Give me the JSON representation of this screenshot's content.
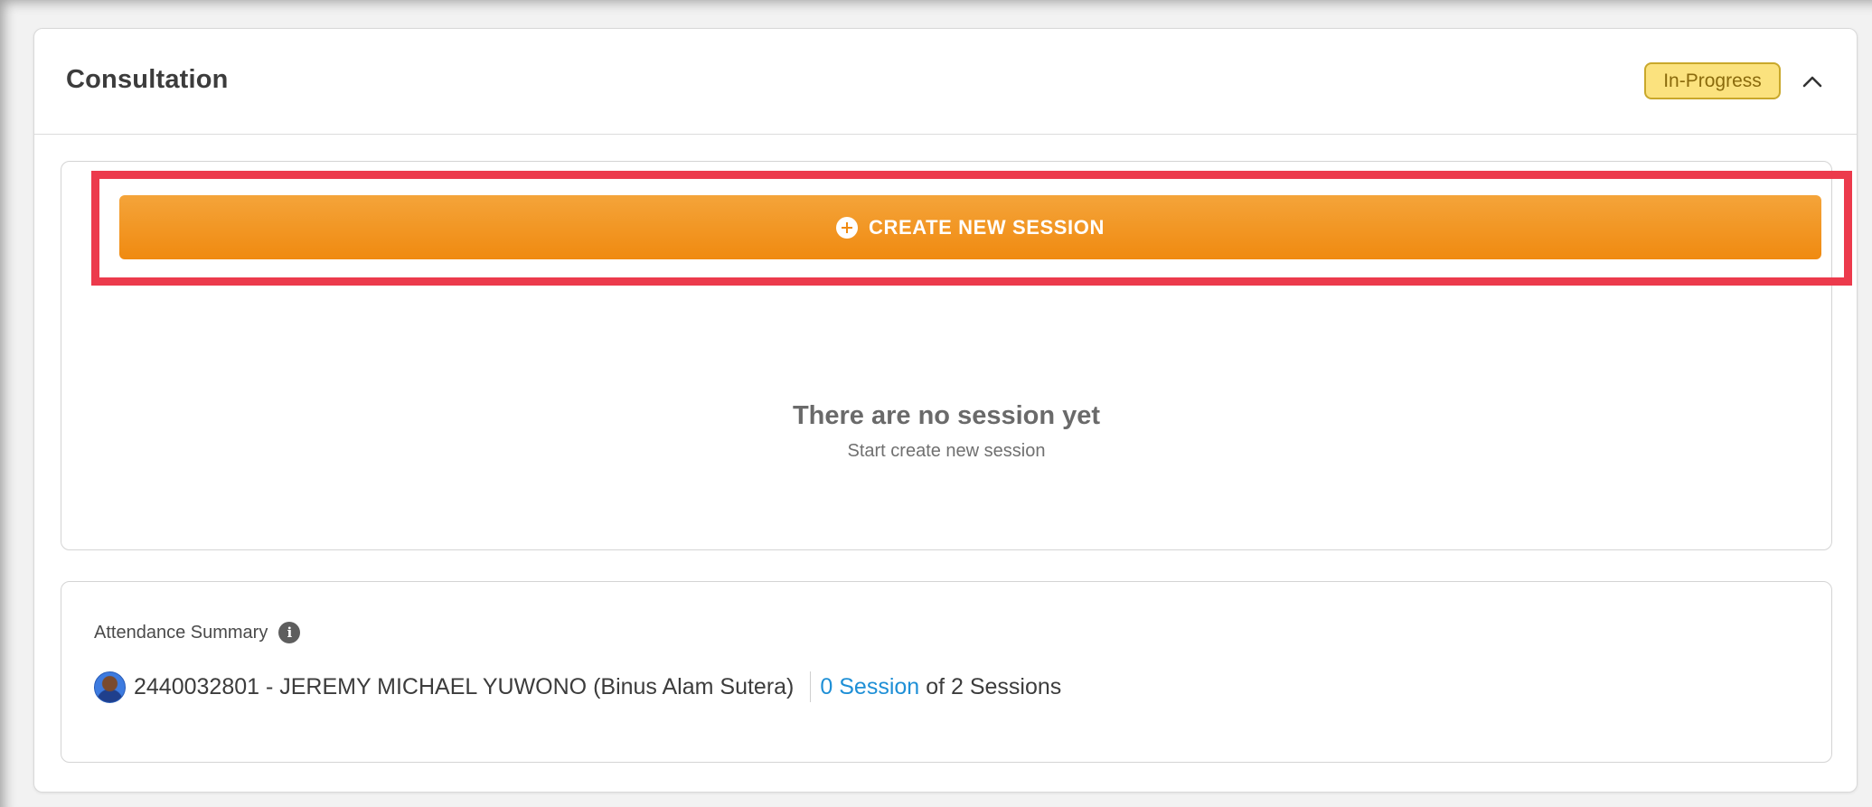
{
  "card": {
    "title": "Consultation",
    "status": "In-Progress"
  },
  "sessions": {
    "create_label": "CREATE NEW SESSION",
    "empty_title": "There are no session yet",
    "empty_subtitle": "Start create new session"
  },
  "attendance": {
    "title": "Attendance Summary",
    "student": "2440032801 - JEREMY MICHAEL YUWONO (Binus Alam Sutera)",
    "attended": "0 Session",
    "total": "of 2 Sessions"
  },
  "colors": {
    "accent": "#f08a10",
    "highlight": "#ec3a4c",
    "badge": "#fbe27e",
    "link": "#1e8fd6"
  },
  "icons": {
    "collapse": "chevron-up-icon",
    "create": "plus-circle-icon",
    "info": "info-icon"
  }
}
